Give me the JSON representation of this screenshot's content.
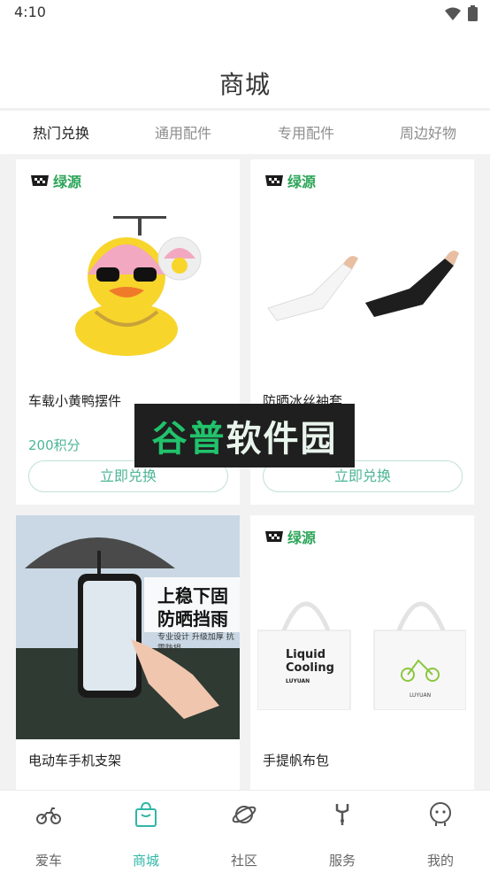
{
  "status": {
    "time": "4:10"
  },
  "header": {
    "title": "商城"
  },
  "tabs": [
    {
      "label": "热门兑换",
      "active": true
    },
    {
      "label": "通用配件",
      "active": false
    },
    {
      "label": "专用配件",
      "active": false
    },
    {
      "label": "周边好物",
      "active": false
    }
  ],
  "brand_name": "绿源",
  "products": [
    {
      "name": "车载小黄鸭摆件",
      "points": "200积分",
      "button": "立即兑换",
      "brand_shown": true
    },
    {
      "name": "防晒冰丝袖套",
      "points": "",
      "button": "立即兑换",
      "brand_shown": true
    },
    {
      "name": "电动车手机支架",
      "image_text_main": "上稳下固\n防晒挡雨",
      "image_text_sub": "专业设计 升级加厚 抗震防损",
      "brand_shown": false
    },
    {
      "name": "手提帆布包",
      "bag_print": [
        "Liquid",
        "Cooling",
        "LUYUAN"
      ],
      "bag2_print": "LUYUAN",
      "brand_shown": true
    }
  ],
  "watermark": {
    "part1": "谷普",
    "part2": "软件园"
  },
  "bottom_nav": [
    {
      "label": "爱车",
      "icon": "motorbike-icon",
      "active": false
    },
    {
      "label": "商城",
      "icon": "shopping-bag-icon",
      "active": true
    },
    {
      "label": "社区",
      "icon": "planet-icon",
      "active": false
    },
    {
      "label": "服务",
      "icon": "wrench-icon",
      "active": false
    },
    {
      "label": "我的",
      "icon": "profile-face-icon",
      "active": false
    }
  ],
  "colors": {
    "accent": "#2fb7a7",
    "points": "#4db596",
    "tab_indicator": "#c53a3a",
    "brand_green": "#2ea65a"
  }
}
